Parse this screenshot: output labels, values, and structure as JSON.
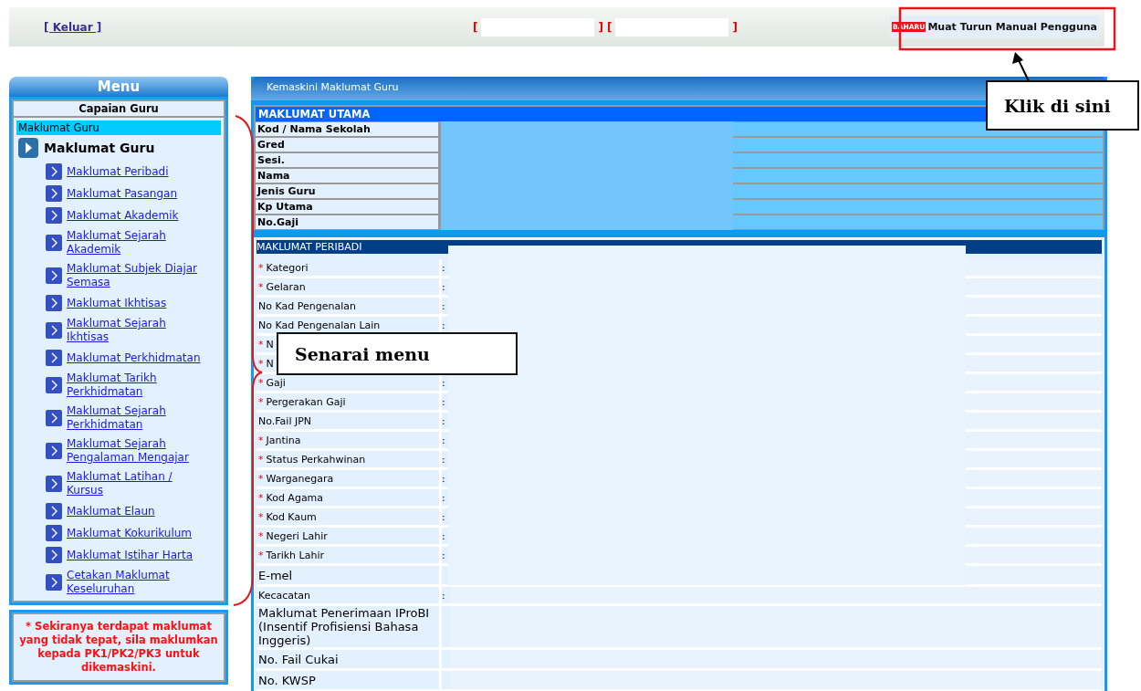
{
  "top_bar": {
    "logout": "[ Keluar ]",
    "slots": [
      {
        "open": "[",
        "close": "]"
      },
      {
        "open": "[",
        "close": "]"
      }
    ],
    "download": {
      "badge": "BAHARU",
      "label": "Muat Turun Manual Pengguna"
    }
  },
  "sidebar": {
    "title": "Menu",
    "section": "Capaian Guru",
    "current": "Maklumat Guru",
    "group": "Maklumat Guru",
    "items": [
      {
        "label": "Maklumat Peribadi"
      },
      {
        "label": "Maklumat Pasangan"
      },
      {
        "label": "Maklumat Akademik"
      },
      {
        "label": "Maklumat Sejarah Akademik"
      },
      {
        "label": "Maklumat Subjek Diajar Semasa"
      },
      {
        "label": "Maklumat Ikhtisas"
      },
      {
        "label": "Maklumat Sejarah Ikhtisas"
      },
      {
        "label": "Maklumat Perkhidmatan"
      },
      {
        "label": "Maklumat Tarikh Perkhidmatan"
      },
      {
        "label": "Maklumat Sejarah Perkhidmatan"
      },
      {
        "label": "Maklumat Sejarah Pengalaman Mengajar"
      },
      {
        "label": "Maklumat Latihan / Kursus"
      },
      {
        "label": "Maklumat Elaun"
      },
      {
        "label": "Maklumat Kokurikulum"
      },
      {
        "label": "Maklumat Istihar Harta"
      },
      {
        "label": "Cetakan Maklumat Keseluruhan"
      }
    ],
    "notice": "* Sekiranya terdapat maklumat yang tidak tepat, sila maklumkan kepada PK1/PK2/PK3 untuk dikemaskini."
  },
  "main": {
    "title": "Kemaskini Maklumat Guru",
    "utama": {
      "heading": "MAKLUMAT UTAMA",
      "rows": [
        "Kod / Nama Sekolah",
        "Gred",
        "Sesi.",
        "Nama",
        "Jenis Guru",
        "Kp Utama",
        "No.Gaji"
      ]
    },
    "peribadi": {
      "heading": "MAKLUMAT PERIBADI",
      "required_mark": "*",
      "rows": [
        {
          "label": "Kategori",
          "required": true,
          "kind": "normal",
          "separator": ":"
        },
        {
          "label": "Gelaran",
          "required": true,
          "kind": "normal",
          "separator": ":"
        },
        {
          "label": "No Kad Pengenalan",
          "required": false,
          "kind": "normal",
          "separator": ":"
        },
        {
          "label": "No Kad Pengenalan Lain",
          "required": false,
          "kind": "normal",
          "separator": ":"
        },
        {
          "label": "N",
          "required": true,
          "kind": "normal"
        },
        {
          "label": "N",
          "required": true,
          "kind": "normal"
        },
        {
          "label": "Gaji",
          "required": true,
          "kind": "normal",
          "separator": ":"
        },
        {
          "label": "Pergerakan Gaji",
          "required": true,
          "kind": "normal",
          "separator": ":"
        },
        {
          "label": "No.Fail JPN",
          "required": false,
          "kind": "normal",
          "separator": ":"
        },
        {
          "label": "Jantina",
          "required": true,
          "kind": "normal",
          "separator": ":"
        },
        {
          "label": "Status Perkahwinan",
          "required": true,
          "kind": "normal",
          "separator": ":"
        },
        {
          "label": "Warganegara",
          "required": true,
          "kind": "normal",
          "separator": ":"
        },
        {
          "label": "Kod Agama",
          "required": true,
          "kind": "normal",
          "separator": ":"
        },
        {
          "label": "Kod Kaum",
          "required": true,
          "kind": "normal",
          "separator": ":"
        },
        {
          "label": "Negeri Lahir",
          "required": true,
          "kind": "normal",
          "separator": ":"
        },
        {
          "label": "Tarikh Lahir",
          "required": true,
          "kind": "normal",
          "separator": ":"
        },
        {
          "label": "E-mel",
          "required": false,
          "kind": "large"
        },
        {
          "label": "Kecacatan",
          "required": false,
          "kind": "normal",
          "separator": ":"
        },
        {
          "label": "Maklumat Penerimaan IProBI (Insentif Profisiensi Bahasa Inggeris)",
          "required": false,
          "kind": "large"
        },
        {
          "label": "No. Fail Cukai",
          "required": false,
          "kind": "large"
        },
        {
          "label": "No. KWSP",
          "required": false,
          "kind": "large"
        }
      ]
    }
  },
  "annotations": [
    {
      "kind": "bracket",
      "text": "Senarai menu"
    },
    {
      "kind": "arrow",
      "text": "Klik di sini"
    }
  ]
}
